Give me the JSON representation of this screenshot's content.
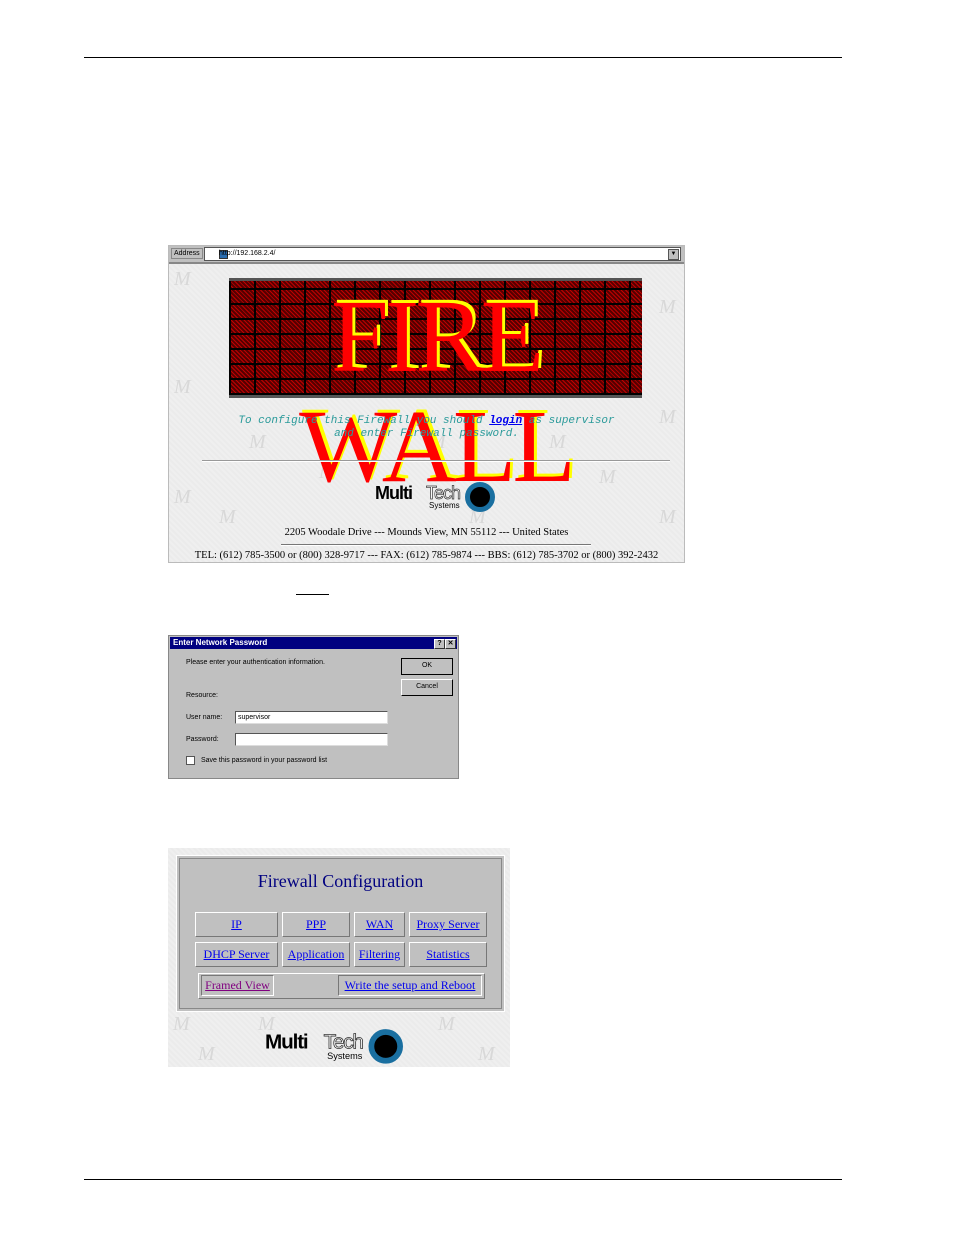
{
  "browser": {
    "address_label": "Address",
    "url": "http://192.168.2.4/",
    "banner_text": "FIRE WALL",
    "instructions": {
      "before": "To configure this Firewall you should ",
      "link": "login",
      "after": " as supervisor",
      "line2": "and enter Firewall password."
    },
    "logo": {
      "multi": "Multi",
      "tech": "Tech",
      "systems": "Systems"
    },
    "address_line": "2205 Woodale Drive --- Mounds View, MN 55112 --- United States",
    "contact_line": "TEL: (612) 785-3500 or (800) 328-9717 --- FAX: (612) 785-9874 --- BBS: (612) 785-3702 or (800) 392-2432"
  },
  "dialog": {
    "title": "Enter Network Password",
    "help": "?",
    "close": "✕",
    "prompt": "Please enter your authentication information.",
    "ok": "OK",
    "cancel": "Cancel",
    "resource_label": "Resource:",
    "username_label": "User name:",
    "username_value": "supervisor",
    "password_label": "Password:",
    "password_value": "",
    "save_label": "Save this password in your password list",
    "save_checked": false
  },
  "config": {
    "title": "Firewall Configuration",
    "links_row1": [
      "IP",
      "PPP",
      "WAN",
      "Proxy Server"
    ],
    "links_row2": [
      "DHCP Server",
      "Application",
      "Filtering",
      "Statistics"
    ],
    "framed_view": "Framed View",
    "write_reboot": "Write the setup and Reboot",
    "logo": {
      "multi": "Multi",
      "tech": "Tech",
      "systems": "Systems"
    }
  },
  "colors": {
    "link": "#0000ee",
    "visited": "#800080",
    "title_bar": "#000080",
    "banner_red": "#ff0000",
    "banner_yellow": "#ffff00",
    "instruction_teal": "#2a9a9a"
  }
}
